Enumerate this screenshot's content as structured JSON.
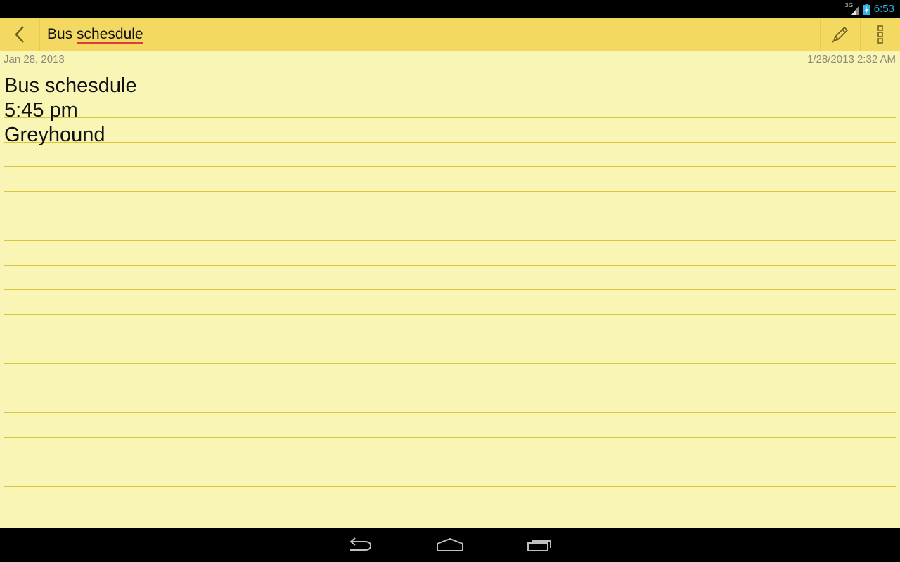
{
  "status_bar": {
    "network_type": "3G",
    "time": "6:53",
    "icons": [
      "signal-icon",
      "battery-charging-icon"
    ]
  },
  "action_bar": {
    "title_word1": "Bus",
    "title_word2": "schesdule",
    "icons": [
      "back-chevron-icon",
      "pencil-icon",
      "overflow-menu-icon"
    ]
  },
  "note": {
    "date": "Jan 28, 2013",
    "modified": "1/28/2013 2:32 AM",
    "lines": [
      "Bus schesdule",
      "5:45 pm",
      "Greyhound"
    ]
  },
  "nav_bar": {
    "icons": [
      "back-icon",
      "home-icon",
      "recent-apps-icon"
    ]
  },
  "colors": {
    "action_bar": "#f3d861",
    "paper": "#f9f6b5",
    "rule_line": "#d6c83a",
    "spell_underline": "#e8393a",
    "status_time": "#33b5e5"
  }
}
